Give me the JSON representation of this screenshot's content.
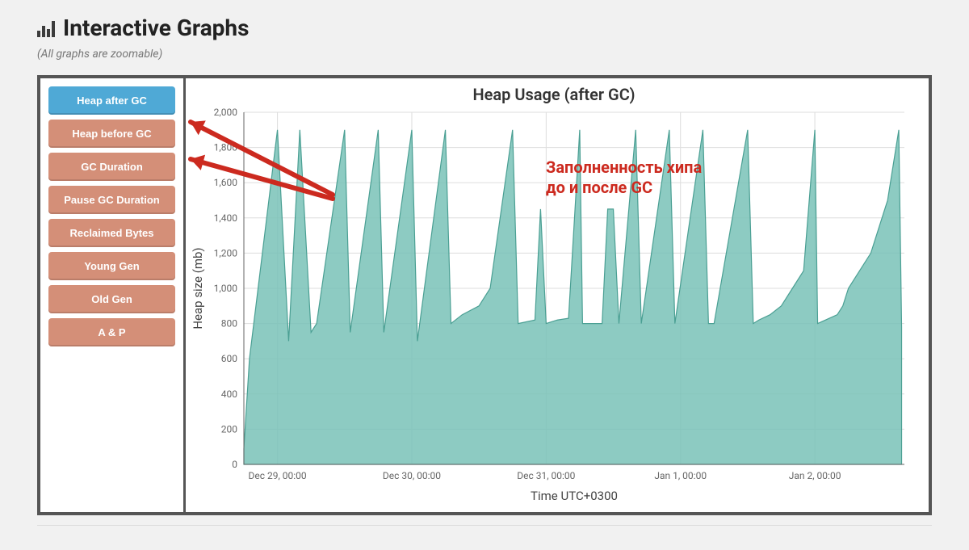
{
  "page": {
    "title": "Interactive Graphs",
    "subtitle": "(All graphs are zoomable)"
  },
  "sidebar": {
    "tabs": [
      {
        "label": "Heap after GC",
        "active": true
      },
      {
        "label": "Heap before GC",
        "active": false
      },
      {
        "label": "GC Duration",
        "active": false
      },
      {
        "label": "Pause GC Duration",
        "active": false
      },
      {
        "label": "Reclaimed Bytes",
        "active": false
      },
      {
        "label": "Young Gen",
        "active": false
      },
      {
        "label": "Old Gen",
        "active": false
      },
      {
        "label": "A & P",
        "active": false
      }
    ]
  },
  "chart": {
    "title": "Heap Usage (after GC)",
    "ylabel": "Heap size (mb)",
    "xlabel": "Time UTC+0300",
    "y_ticks": [
      0,
      200,
      400,
      600,
      800,
      1000,
      1200,
      1400,
      1600,
      1800,
      2000
    ],
    "x_ticks": [
      "Dec 29, 00:00",
      "Dec 30, 00:00",
      "Dec 31, 00:00",
      "Jan 1, 00:00",
      "Jan 2, 00:00"
    ],
    "colors": {
      "area": "#79c2b7",
      "line": "#4a9f93",
      "grid": "#dddddd",
      "axis": "#666666"
    }
  },
  "annotation": {
    "line1": "Заполненность хипа",
    "line2": "до и после GC",
    "color": "#cc2a1f"
  },
  "chart_data": {
    "type": "area",
    "title": "Heap Usage (after GC)",
    "xlabel": "Time UTC+0300",
    "ylabel": "Heap size (mb)",
    "ylim": [
      0,
      2000
    ],
    "x_range": [
      "Dec 28 18:00",
      "Jan 2 16:00"
    ],
    "x_ticks": [
      "Dec 29, 00:00",
      "Dec 30, 00:00",
      "Dec 31, 00:00",
      "Jan 1, 00:00",
      "Jan 2, 00:00"
    ],
    "series": [
      {
        "name": "Heap after GC (mb)",
        "x_hours_from_start": [
          0,
          1,
          6,
          8,
          10,
          12,
          13,
          18,
          19,
          24,
          25,
          30,
          31,
          36,
          37,
          39,
          42,
          44,
          48,
          49,
          52,
          53,
          54,
          56,
          58,
          60,
          60.5,
          64,
          65,
          66,
          67,
          70,
          71,
          76,
          77,
          82,
          83,
          84,
          90,
          91,
          92,
          94,
          96,
          98,
          100,
          102,
          102.5,
          106,
          107,
          108,
          110,
          112,
          113,
          115,
          116,
          117,
          117.5
        ],
        "y_mb": [
          90,
          600,
          1900,
          700,
          1900,
          750,
          800,
          1900,
          750,
          1900,
          750,
          1900,
          700,
          1900,
          800,
          850,
          900,
          1000,
          1900,
          800,
          820,
          1450,
          800,
          820,
          830,
          1900,
          800,
          800,
          1450,
          1450,
          800,
          1900,
          800,
          1900,
          800,
          1900,
          800,
          800,
          1900,
          800,
          820,
          850,
          900,
          1000,
          1100,
          1900,
          800,
          850,
          900,
          1000,
          1100,
          1200,
          1300,
          1500,
          1700,
          1900,
          780
        ]
      }
    ]
  }
}
